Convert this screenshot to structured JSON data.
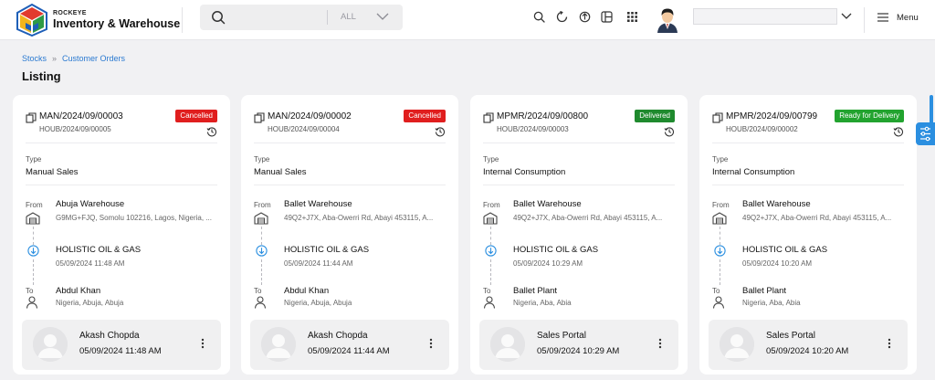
{
  "app": {
    "brand_small": "ROCKEYE",
    "brand_name": "Inventory & Warehouse"
  },
  "search": {
    "category": "ALL"
  },
  "header": {
    "menu_label": "Menu"
  },
  "breadcrumb": {
    "items": [
      "Stocks",
      "Customer Orders"
    ]
  },
  "page": {
    "title": "Listing"
  },
  "colors": {
    "cancelled": "#e01e1e",
    "delivered": "#1f8a2e",
    "ready": "#22a32f",
    "accent": "#2b8fe0"
  },
  "labels": {
    "type": "Type",
    "from": "From",
    "to": "To"
  },
  "cards": [
    {
      "number": "MAN/2024/09/00003",
      "ref": "HOUB/2024/09/00005",
      "status": "Cancelled",
      "type": "Manual Sales",
      "from_name": "Abuja Warehouse",
      "from_address": "G9MG+FJQ, Somolu 102216, Lagos, Nigeria, ...",
      "via_name": "HOLISTIC OIL & GAS",
      "via_date": "05/09/2024 11:48 AM",
      "to_name": "Abdul Khan",
      "to_address": "Nigeria, Abuja, Abuja",
      "user_name": "Akash Chopda",
      "user_date": "05/09/2024 11:48 AM"
    },
    {
      "number": "MAN/2024/09/00002",
      "ref": "HOUB/2024/09/00004",
      "status": "Cancelled",
      "type": "Manual Sales",
      "from_name": "Ballet Warehouse",
      "from_address": "49Q2+J7X, Aba-Owerri Rd, Abayi 453115, A...",
      "via_name": "HOLISTIC OIL & GAS",
      "via_date": "05/09/2024 11:44 AM",
      "to_name": "Abdul Khan",
      "to_address": "Nigeria, Abuja, Abuja",
      "user_name": "Akash Chopda",
      "user_date": "05/09/2024 11:44 AM"
    },
    {
      "number": "MPMR/2024/09/00800",
      "ref": "HOUB/2024/09/00003",
      "status": "Delivered",
      "type": "Internal Consumption",
      "from_name": "Ballet Warehouse",
      "from_address": "49Q2+J7X, Aba-Owerri Rd, Abayi 453115, A...",
      "via_name": "HOLISTIC OIL & GAS",
      "via_date": "05/09/2024 10:29 AM",
      "to_name": "Ballet Plant",
      "to_address": "Nigeria, Aba, Abia",
      "user_name": "Sales Portal",
      "user_date": "05/09/2024 10:29 AM"
    },
    {
      "number": "MPMR/2024/09/00799",
      "ref": "HOUB/2024/09/00002",
      "status": "Ready for Delivery",
      "type": "Internal Consumption",
      "from_name": "Ballet Warehouse",
      "from_address": "49Q2+J7X, Aba-Owerri Rd, Abayi 453115, A...",
      "via_name": "HOLISTIC OIL & GAS",
      "via_date": "05/09/2024 10:20 AM",
      "to_name": "Ballet Plant",
      "to_address": "Nigeria, Aba, Abia",
      "user_name": "Sales Portal",
      "user_date": "05/09/2024 10:20 AM"
    }
  ]
}
